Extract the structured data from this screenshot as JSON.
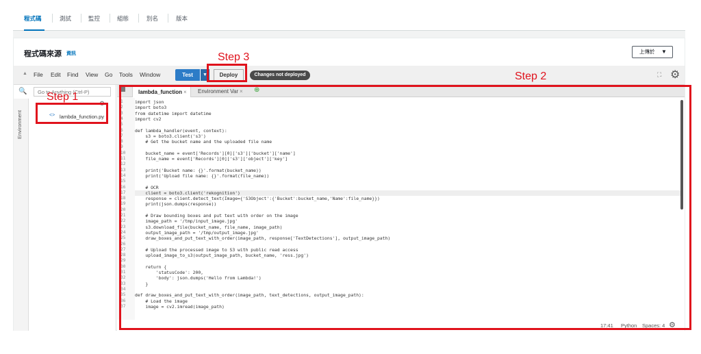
{
  "tabs": [
    "程式碼",
    "測試",
    "監控",
    "組態",
    "別名",
    "版本"
  ],
  "source": {
    "title": "程式碼來源",
    "info": "資訊",
    "upload_label": "上傳於",
    "upload_caret": "▼"
  },
  "menubar": {
    "collapse_icon": "▲",
    "items": [
      "File",
      "Edit",
      "Find",
      "View",
      "Go",
      "Tools",
      "Window"
    ],
    "test_label": "Test",
    "test_caret": "▼",
    "deploy_label": "Deploy",
    "changes_badge": "Changes not deployed",
    "expand_icon": "⛶",
    "gear_icon": "⚙"
  },
  "sidebar": {
    "search_icon": "🔍",
    "goto_placeholder": "Go to Anything (Ctrl-P)",
    "vertical_tab": "Environment",
    "tree_header": "",
    "file_icon": "<>",
    "file_name": "lambda_function.py"
  },
  "editor": {
    "tabs": [
      {
        "label": "lambda_function",
        "close": "×"
      },
      {
        "label": "Environment Var",
        "close": "×"
      }
    ],
    "add_tab_icon": "⊕",
    "highlighted_line": 17,
    "lines": [
      "import json",
      "import boto3",
      "from datetime import datetime",
      "import cv2",
      "",
      "def lambda_handler(event, context):",
      "    s3 = boto3.client('s3')",
      "    # Get the bucket name and the uploaded file name",
      "",
      "    bucket_name = event['Records'][0]['s3']['bucket']['name']",
      "    file_name = event['Records'][0]['s3']['object']['key']",
      "",
      "    print('Bucket name: {}'.format(bucket_name))",
      "    print('Upload file name: {}'.format(file_name))",
      "",
      "    # OCR",
      "    client = boto3.client('rekognition')",
      "    response = client.detect_text(Image={'S3Object':{'Bucket':bucket_name,'Name':file_name}})",
      "    print(json.dumps(response))",
      "",
      "    # Draw bounding boxes and put text with order on the image",
      "    image_path = '/tmp/input_image.jpg'",
      "    s3.download_file(bucket_name, file_name, image_path)",
      "    output_image_path = '/tmp/output_image.jpg'",
      "    draw_boxes_and_put_text_with_order(image_path, response['TextDetections'], output_image_path)",
      "",
      "    # Upload the processed image to S3 with public read access",
      "    upload_image_to_s3(output_image_path, bucket_name, 'ress.jpg')",
      "",
      "    return {",
      "        'statusCode': 200,",
      "        'body': json.dumps('Hello from Lambda!')",
      "    }",
      "",
      "def draw_boxes_and_put_text_with_order(image_path, text_detections, output_image_path):",
      "    # Load the image",
      "    image = cv2.imread(image_path)"
    ],
    "status": {
      "position": "17:41",
      "language": "Python",
      "spaces": "Spaces: 4",
      "gear_icon": "⚙"
    }
  },
  "annotations": {
    "step1": "Step 1",
    "step2": "Step 2",
    "step3": "Step 3",
    "color": "#e0121c"
  }
}
